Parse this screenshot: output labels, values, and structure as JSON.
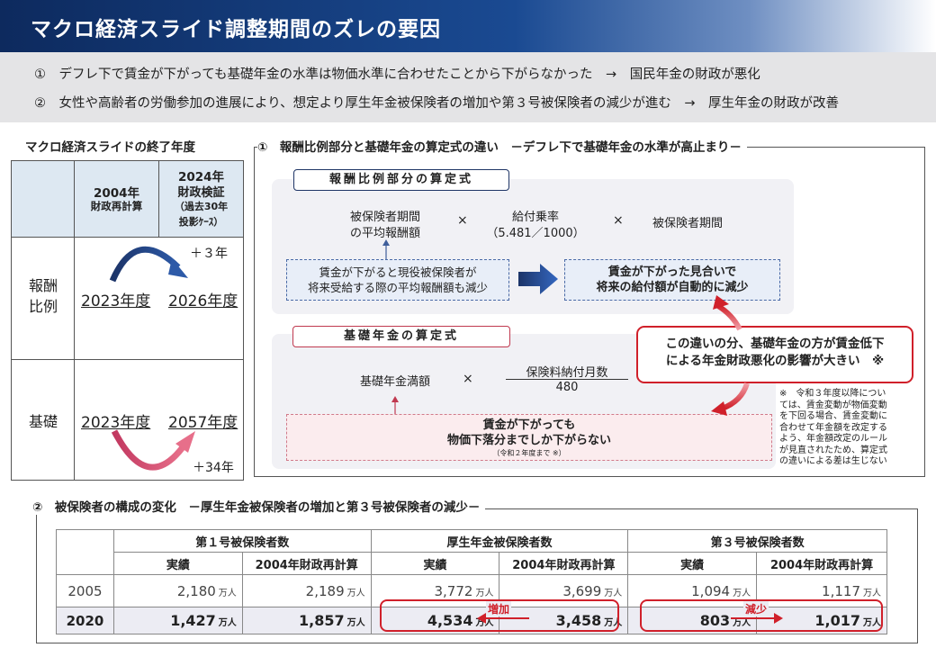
{
  "title": "マクロ経済スライド調整期間のズレの要因",
  "summary": [
    "①　デフレ下で賃金が下がっても基礎年金の水準は物価水準に合わせたことから下がらなかった　→　国民年金の財政が悪化",
    "②　女性や高齢者の労働参加の進展により、想定より厚生年金被保険者の増加や第３号被保険者の減少が進む　→　厚生年金の財政が改善"
  ],
  "end_year": {
    "title": "マクロ経済スライドの終了年度",
    "col1_a": "2004年",
    "col1_b": "財政再計算",
    "col2_a": "2024年",
    "col2_b": "財政検証",
    "col2_c": "（過去30年",
    "col2_d": "投影ｹｰｽ）",
    "row1_a": "報酬",
    "row1_b": "比例",
    "row1_v1": "2023年度",
    "row1_v2": "2026年度",
    "row1_diff": "＋３年",
    "row2": "基礎",
    "row2_v1": "2023年度",
    "row2_v2": "2057年度",
    "row2_diff": "＋34年"
  },
  "formula": {
    "title": "①　報酬比例部分と基礎年金の算定式の違い　－デフレ下で基礎年金の水準が高止まり－",
    "hirei_label": "報酬比例部分の算定式",
    "hirei_t1a": "被保険者期間",
    "hirei_t1b": "の平均報酬額",
    "times": "×",
    "hirei_t2a": "給付乗率",
    "hirei_t2b": "（5.481／1000）",
    "hirei_t3": "被保険者期間",
    "hirei_note_a": "賃金が下がると現役被保険者が",
    "hirei_note_b": "将来受給する際の平均報酬額も減少",
    "hirei_result_a": "賃金が下がった見合いで",
    "hirei_result_b": "将来の給付額が自動的に減少",
    "kiso_label": "基礎年金の算定式",
    "kiso_t1": "基礎年金満額",
    "kiso_num": "保険料納付月数",
    "kiso_den": "480",
    "kiso_note_a": "賃金が下がっても",
    "kiso_note_b": "物価下落分までしか下がらない",
    "kiso_note_c": "（令和２年度まで ※）",
    "callout_a": "この違いの分、基礎年金の方が賃金低下",
    "callout_b": "による年金財政悪化の影響が大きい　※",
    "footnote": [
      "※　令和３年度以降につい",
      "ては、賃金変動が物価変動",
      "を下回る場合、賃金変動に",
      "合わせて年金額を改定する",
      "よう、年金額改定のルール",
      "が見直されたため、算定式",
      "の違いによる差は生じない"
    ]
  },
  "composition": {
    "title": "②　被保険者の構成の変化　－厚生年金被保険者の増加と第３号被保険者の減少－",
    "groups": [
      "第１号被保険者数",
      "厚生年金被保険者数",
      "第３号被保険者数"
    ],
    "subheaders": [
      "実績",
      "2004年財政再計算"
    ],
    "unit": "万人",
    "rows": [
      {
        "year": "2005",
        "values": [
          "2,180",
          "2,189",
          "3,772",
          "3,699",
          "1,094",
          "1,117"
        ]
      },
      {
        "year": "2020",
        "values": [
          "1,427",
          "1,857",
          "4,534",
          "3,458",
          "803",
          "1,017"
        ]
      }
    ],
    "increase_label": "増加",
    "decrease_label": "減少"
  }
}
